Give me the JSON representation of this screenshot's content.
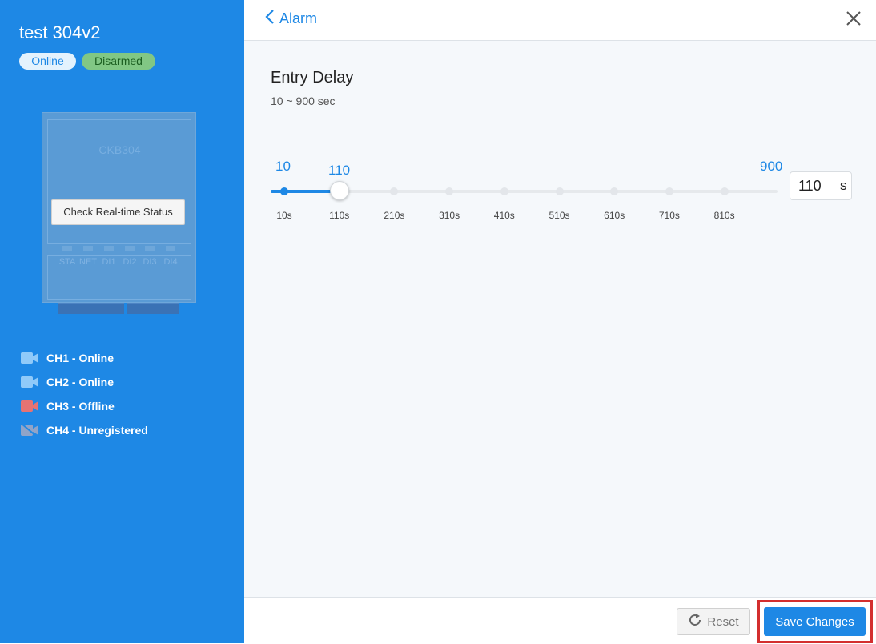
{
  "device": {
    "name": "test 304v2",
    "status_online": "Online",
    "status_armed": "Disarmed",
    "model": "CKB304",
    "check_status_label": "Check Real-time Status",
    "led_labels": [
      "STA",
      "NET",
      "DI1",
      "DI2",
      "DI3",
      "DI4"
    ]
  },
  "channels": [
    {
      "label": "CH1 - Online",
      "icon": "camera-icon",
      "color": "#90caf9"
    },
    {
      "label": "CH2 - Online",
      "icon": "camera-icon",
      "color": "#90caf9"
    },
    {
      "label": "CH3 - Offline",
      "icon": "camera-icon",
      "color": "#e57373"
    },
    {
      "label": "CH4 - Unregistered",
      "icon": "camera-off-icon",
      "color": "#90a4c8"
    }
  ],
  "header": {
    "back_label": "Alarm"
  },
  "setting": {
    "title": "Entry Delay",
    "range_text": "10 ~ 900 sec",
    "min_label": "10",
    "current_label": "110",
    "max_label": "900",
    "value": "110",
    "unit": "s",
    "min": 10,
    "max": 900,
    "current": 110,
    "ticks": [
      "10s",
      "110s",
      "210s",
      "310s",
      "410s",
      "510s",
      "610s",
      "710s",
      "810s"
    ]
  },
  "footer": {
    "reset_label": "Reset",
    "save_label": "Save Changes"
  },
  "colors": {
    "accent": "#1e88e5",
    "highlight": "#d32f2f"
  }
}
